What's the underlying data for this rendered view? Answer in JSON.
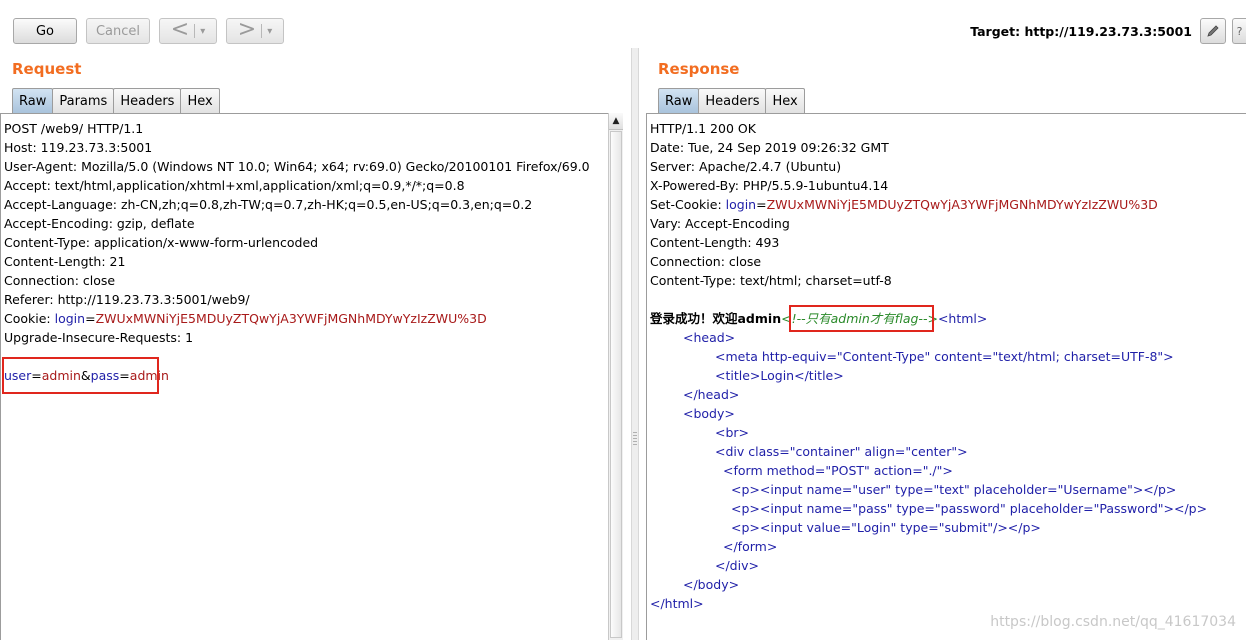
{
  "toolbar": {
    "go_label": "Go",
    "cancel_label": "Cancel",
    "back_glyph": "<",
    "forward_glyph": ">",
    "dropdown_glyph": "▾",
    "target_label": "Target: http://119.23.73.3:5001",
    "edit_icon": "pencil-icon",
    "help_icon": "help-icon"
  },
  "request": {
    "title": "Request",
    "tabs": [
      "Raw",
      "Params",
      "Headers",
      "Hex"
    ],
    "active_tab": "Raw",
    "lines": [
      "POST /web9/ HTTP/1.1",
      "Host: 119.23.73.3:5001",
      "User-Agent: Mozilla/5.0 (Windows NT 10.0; Win64; x64; rv:69.0) Gecko/20100101 Firefox/69.0",
      "Accept: text/html,application/xhtml+xml,application/xml;q=0.9,*/*;q=0.8",
      "Accept-Language: zh-CN,zh;q=0.8,zh-TW;q=0.7,zh-HK;q=0.5,en-US;q=0.3,en;q=0.2",
      "Accept-Encoding: gzip, deflate",
      "Content-Type: application/x-www-form-urlencoded",
      "Content-Length: 21",
      "Connection: close",
      "Referer: http://119.23.73.3:5001/web9/"
    ],
    "cookie": {
      "prefix": "Cookie: ",
      "name": "login",
      "eq": "=",
      "value": "ZWUxMWNiYjE5MDUyZTQwYjA3YWFjMGNhMDYwYzIzZWU%3D"
    },
    "upgrade_line": "Upgrade-Insecure-Requests: 1",
    "body": {
      "p1_name": "user",
      "p1_value": "admin",
      "amp": "&",
      "p2_name": "pass",
      "p2_value": "admin",
      "eq": "="
    }
  },
  "response": {
    "title": "Response",
    "tabs": [
      "Raw",
      "Headers",
      "Hex"
    ],
    "active_tab": "Raw",
    "lines": [
      "HTTP/1.1 200 OK",
      "Date: Tue, 24 Sep 2019 09:26:32 GMT",
      "Server: Apache/2.4.7 (Ubuntu)",
      "X-Powered-By: PHP/5.5.9-1ubuntu4.14"
    ],
    "set_cookie": {
      "prefix": "Set-Cookie: ",
      "name": "login",
      "eq": "=",
      "value": "ZWUxMWNiYjE5MDUyZTQwYjA3YWFjMGNhMDYwYzIzZWU%3D"
    },
    "lines2": [
      "Vary: Accept-Encoding",
      "Content-Length: 493",
      "Connection: close",
      "Content-Type: text/html; charset=utf-8"
    ],
    "body_text": "登录成功！欢迎admin",
    "comment": "<!--只有admin才有flag-->",
    "html_lines": [
      "<html>",
      "<head>",
      "<meta http-equiv=\"Content-Type\" content=\"text/html; charset=UTF-8\">",
      "<title>Login</title>",
      "</head>",
      "<body>",
      "<br>",
      "<div class=\"container\" align=\"center\">",
      "<form method=\"POST\" action=\"./\">",
      "<p><input name=\"user\" type=\"text\" placeholder=\"Username\"></p>",
      "<p><input name=\"pass\" type=\"password\" placeholder=\"Password\"></p>",
      "<p><input value=\"Login\" type=\"submit\"/></p>",
      "</form>",
      "</div>",
      "</body>",
      "</html>"
    ]
  },
  "watermark": "https://blog.csdn.net/qq_41617034",
  "colors": {
    "accent": "#f26d21",
    "attr_name": "#1f1fa8",
    "attr_value": "#a81a1a",
    "comment": "#2a8a2a",
    "highlight": "#e0261d"
  }
}
